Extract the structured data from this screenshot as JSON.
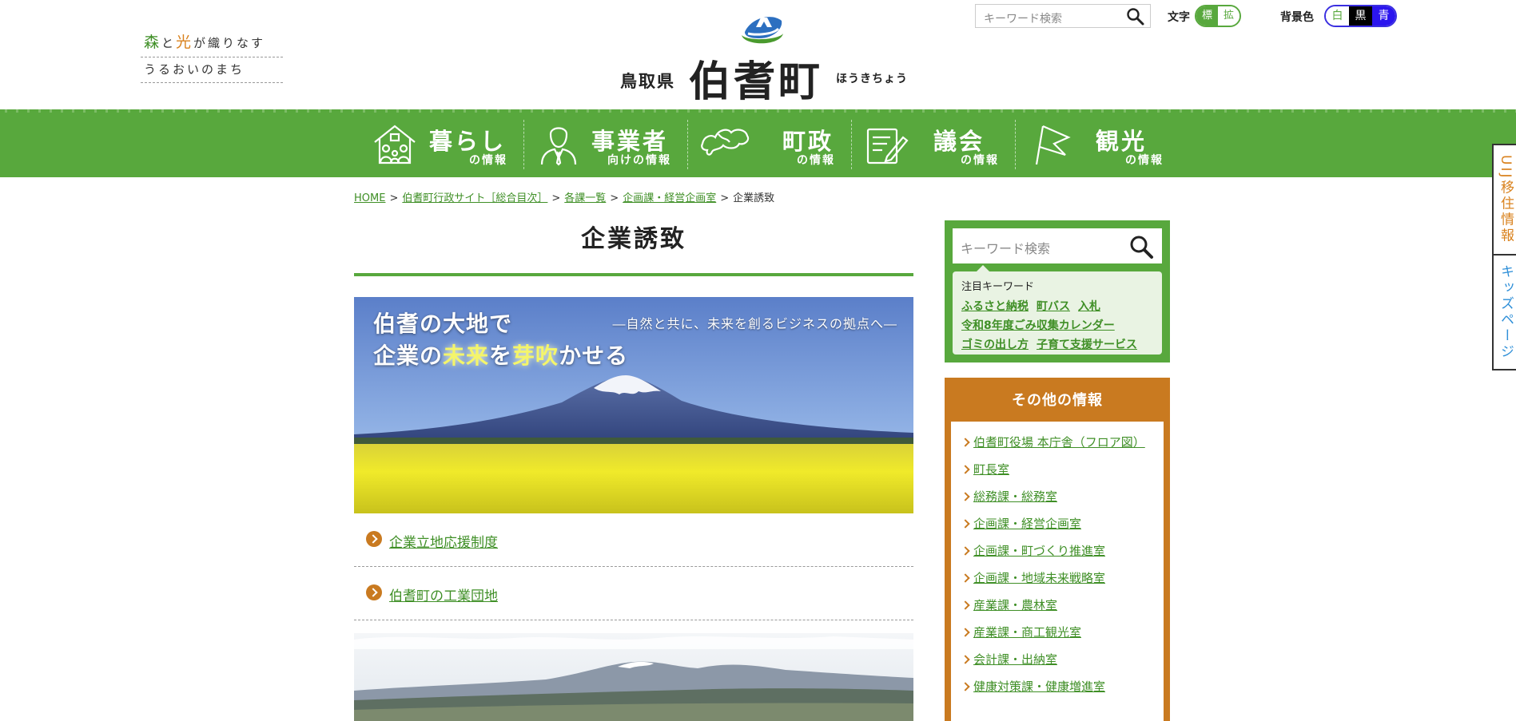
{
  "header": {
    "tagline_line1": [
      "森",
      "と",
      "光",
      "が織りなす"
    ],
    "tagline_line2": "うるおいのまち",
    "pref": "鳥取県",
    "town": "伯耆町",
    "town_kana": "ほうきちょう",
    "search_placeholder": "キーワード検索",
    "font_label": "文字",
    "font_standard": "標準",
    "font_large": "拡大",
    "bg_label": "背景色",
    "bg_white": "白",
    "bg_black": "黒",
    "bg_blue": "青"
  },
  "nav": [
    {
      "main": "暮らし",
      "sub": "の情報",
      "icon": "house-family-icon"
    },
    {
      "main": "事業者",
      "sub": "向けの情報",
      "icon": "businessman-icon"
    },
    {
      "main": "町政",
      "sub": "の情報",
      "icon": "town-map-icon"
    },
    {
      "main": "議会",
      "sub": "の情報",
      "icon": "notepad-pen-icon"
    },
    {
      "main": "観光",
      "sub": "の情報",
      "icon": "flag-icon"
    }
  ],
  "side_tabs": [
    "UIJ移住情報",
    "キッズページ"
  ],
  "breadcrumb": {
    "items": [
      "HOME",
      "伯耆町行政サイト［総合目次］",
      "各課一覧",
      "企画課・経営企画室"
    ],
    "current": "企業誘致",
    "separator": ">"
  },
  "main": {
    "title": "企業誘致",
    "banner_line1": "伯耆の大地で",
    "banner_line2_a": "企業の",
    "banner_line2_b": "未来",
    "banner_line2_c": "を",
    "banner_line2_d": "芽吹",
    "banner_line2_e": "かせる",
    "banner_sub": "―自然と共に、未来を創るビジネスの拠点へ―",
    "links": [
      "企業立地応援制度",
      "伯耆町の工業団地"
    ]
  },
  "sidebar": {
    "search_placeholder": "キーワード検索",
    "keywords_heading": "注目キーワード",
    "keywords_row1": [
      "ふるさと納税",
      "町バス",
      "入札"
    ],
    "keywords_row2": [
      "令和8年度ごみ収集カレンダー"
    ],
    "keywords_row3": [
      "ゴミの出し方",
      "子育て支援サービス"
    ],
    "other_heading": "その他の情報",
    "other_links": [
      "伯耆町役場 本庁舎（フロア図）",
      "町長室",
      "総務課・総務室",
      "企画課・経営企画室",
      "企画課・町づくり推進室",
      "企画課・地域未来戦略室",
      "産業課・農林室",
      "産業課・商工観光室",
      "会計課・出納室",
      "健康対策課・健康増進室"
    ]
  },
  "colors": {
    "green": "#58a83d",
    "link_green": "#3f8f26",
    "orange": "#c97a20",
    "blue_bg_option": "#2b15ee"
  }
}
